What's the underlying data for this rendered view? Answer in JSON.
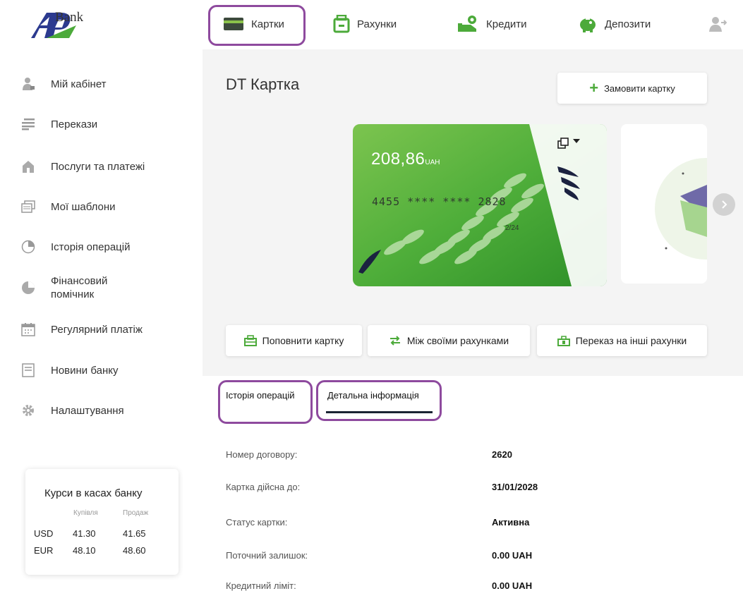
{
  "header": {
    "logo_text": "Bank",
    "nav": [
      {
        "label": "Картки",
        "icon": "card-icon"
      },
      {
        "label": "Рахунки",
        "icon": "wallet-icon"
      },
      {
        "label": "Кредити",
        "icon": "credit-icon"
      },
      {
        "label": "Депозити",
        "icon": "piggy-bank-icon"
      }
    ],
    "user_icon": "user-logout-icon"
  },
  "sidebar": {
    "items": [
      {
        "label": "Мій кабінет",
        "icon": "user-icon"
      },
      {
        "label": "Перекази",
        "icon": "transfer-icon"
      },
      {
        "label": "Послуги та платежі",
        "icon": "services-icon"
      },
      {
        "label": "Мої шаблони",
        "icon": "templates-icon"
      },
      {
        "label": "Історія операцій",
        "icon": "history-icon"
      },
      {
        "label": "Фінансовий помічник",
        "icon": "pie-chart-icon"
      },
      {
        "label": "Регулярний платіж",
        "icon": "calendar-icon"
      },
      {
        "label": "Новини банку",
        "icon": "news-icon"
      },
      {
        "label": "Налаштування",
        "icon": "gear-icon"
      }
    ],
    "rates": {
      "title": "Курси в касах банку",
      "buy_label": "Купівля",
      "sell_label": "Продаж",
      "rows": [
        {
          "currency": "USD",
          "buy": "41.30",
          "sell": "41.65"
        },
        {
          "currency": "EUR",
          "buy": "48.10",
          "sell": "48.60"
        }
      ]
    }
  },
  "main": {
    "title": "DT Картка",
    "order_button": "Замовити картку",
    "card": {
      "balance": "208,86",
      "currency": "UAH",
      "number": "4455 **** **** 2828",
      "expiry": "2/24"
    },
    "actions": [
      {
        "label": "Поповнити картку",
        "icon": "topup-icon"
      },
      {
        "label": "Між своїми рахунками",
        "icon": "exchange-icon"
      },
      {
        "label": "Переказ на інші рахунки",
        "icon": "send-icon"
      }
    ],
    "tabs": [
      {
        "label": "Історія операцій"
      },
      {
        "label": "Детальна інформація"
      }
    ],
    "details": [
      {
        "label": "Номер договору:",
        "value": "2620"
      },
      {
        "label": "Картка дійсна до:",
        "value": "31/01/2028"
      },
      {
        "label": "Статус картки:",
        "value": "Активна"
      },
      {
        "label": "Поточний залишок:",
        "value": "0.00 UAH"
      },
      {
        "label": "Кредитний ліміт:",
        "value": "0.00 UAH"
      }
    ]
  },
  "colors": {
    "accent_green": "#4caa3a",
    "highlight_purple": "#8e4a9e",
    "top_background": "#f4f4f4"
  }
}
